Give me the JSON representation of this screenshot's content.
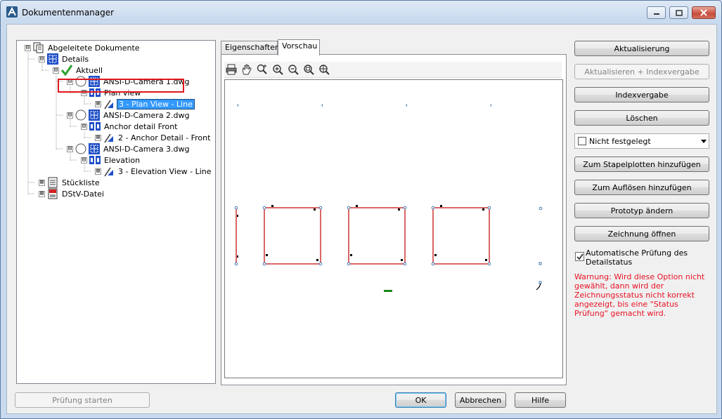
{
  "window": {
    "title": "Dokumentenmanager",
    "controls": {
      "minimize": "minimize",
      "maximize": "maximize",
      "close": "close"
    }
  },
  "tree": {
    "nodes": [
      {
        "label": "Abgeleitete Dokumente",
        "icon": "documents-icon",
        "expander": "⊟"
      },
      {
        "label": "Details",
        "icon": "drawing-sheet-icon",
        "expander": "⊟"
      },
      {
        "label": "Aktuell",
        "icon": "green-check-icon",
        "expander": "⊟"
      },
      {
        "label": "ANSI-D-Camera 1.dwg",
        "icon": "drawing-sheet-icon",
        "expander": "⊟"
      },
      {
        "label": "Plan view",
        "icon": "view-icon",
        "expander": "⊟"
      },
      {
        "label": "3 - Plan View - Line",
        "icon": "blue-pen-icon",
        "expander": "⊞",
        "selected": true
      },
      {
        "label": "ANSI-D-Camera 2.dwg",
        "icon": "drawing-sheet-icon",
        "expander": "⊟"
      },
      {
        "label": "Anchor detail Front",
        "icon": "view-icon",
        "expander": "⊟"
      },
      {
        "label": "2 - Anchor Detail - Front",
        "icon": "blue-pen-icon",
        "expander": "⊞"
      },
      {
        "label": "ANSI-D-Camera 3.dwg",
        "icon": "drawing-sheet-icon",
        "expander": "⊟"
      },
      {
        "label": "Elevation",
        "icon": "view-icon",
        "expander": "⊟"
      },
      {
        "label": "3 - Elevation View - Line",
        "icon": "blue-pen-icon",
        "expander": "⊞"
      },
      {
        "label": "Stückliste",
        "icon": "parts-list-icon",
        "expander": "⊞"
      },
      {
        "label": "DStV-Datei",
        "icon": "dstv-file-icon",
        "expander": "⊞"
      }
    ]
  },
  "tabs": [
    {
      "label": "Eigenschaften",
      "active": false
    },
    {
      "label": "Vorschau",
      "active": true
    }
  ],
  "preview_toolbar": [
    "print-icon",
    "pan-icon",
    "zoom-realtime-icon",
    "zoom-in-icon",
    "zoom-out-icon",
    "zoom-window-icon",
    "zoom-extents-icon"
  ],
  "right_panel": {
    "buttons": {
      "aktualisierung": "Aktualisierung",
      "aktualisieren_index": "Aktualisieren + Indexvergabe",
      "indexvergabe": "Indexvergabe",
      "loeschen": "Löschen",
      "stapelplotten": "Zum Stapelplotten hinzufügen",
      "aufloesen": "Zum Auflösen hinzufügen",
      "prototyp": "Prototyp ändern",
      "zeichnung": "Zeichnung öffnen"
    },
    "status_select": {
      "value": "Nicht festgelegt"
    },
    "auto_check": {
      "label": "Automatische Prüfung des Detailstatus",
      "checked": true
    },
    "warning": "Warnung: Wird diese Option nicht gewählt, dann wird der Zeichnungsstatus nicht korrekt angezeigt, bis eine \"Status Prüfung\" gemacht wird."
  },
  "footer": {
    "pruefung": "Prüfung starten",
    "ok": "OK",
    "abbrechen": "Abbrechen",
    "hilfe": "Hilfe"
  },
  "colors": {
    "selection": "#3399ff",
    "highlight_box": "#e0161c",
    "warning_text": "#e81123",
    "drawing_line": "#c00000"
  }
}
